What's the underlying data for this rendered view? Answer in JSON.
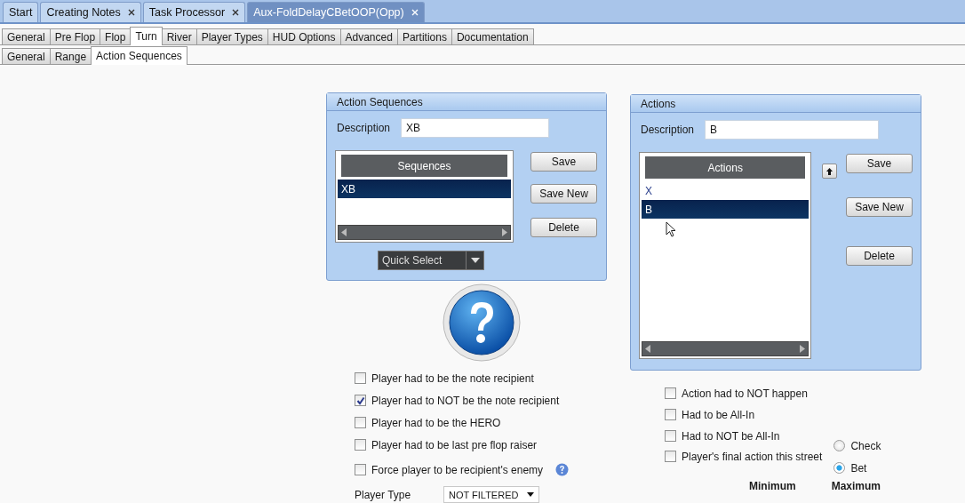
{
  "doc_tabs": [
    {
      "label": "Start",
      "closable": false,
      "selected": false
    },
    {
      "label": "Creating Notes",
      "closable": true,
      "selected": false
    },
    {
      "label": "Task Processor",
      "closable": true,
      "selected": false
    },
    {
      "label": "Aux-FoldDelayCBetOOP(Opp)",
      "closable": true,
      "selected": true
    }
  ],
  "main_tabs": [
    {
      "label": "General",
      "selected": false
    },
    {
      "label": "Pre Flop",
      "selected": false
    },
    {
      "label": "Flop",
      "selected": false
    },
    {
      "label": "Turn",
      "selected": true
    },
    {
      "label": "River",
      "selected": false
    },
    {
      "label": "Player Types",
      "selected": false
    },
    {
      "label": "HUD Options",
      "selected": false
    },
    {
      "label": "Advanced",
      "selected": false
    },
    {
      "label": "Partitions",
      "selected": false
    },
    {
      "label": "Documentation",
      "selected": false
    }
  ],
  "sub_tabs": [
    {
      "label": "General",
      "selected": false
    },
    {
      "label": "Range",
      "selected": false
    },
    {
      "label": "Action Sequences",
      "selected": true
    }
  ],
  "sequences_panel": {
    "title": "Action Sequences",
    "description_label": "Description",
    "description": "XB",
    "list_header": "Sequences",
    "rows": [
      {
        "label": "XB",
        "selected": true
      }
    ],
    "buttons": [
      "Save",
      "Save New",
      "Delete"
    ],
    "quick_select": "Quick Select"
  },
  "actions_panel": {
    "title": "Actions",
    "description_label": "Description",
    "description": "B",
    "list_header": "Actions",
    "rows": [
      {
        "label": "X",
        "selected": false
      },
      {
        "label": "B",
        "selected": true
      }
    ],
    "buttons": [
      "Save",
      "Save New",
      "Delete"
    ]
  },
  "left_options": [
    {
      "label": "Player had to be the note recipient",
      "checked": false,
      "help": false
    },
    {
      "label": "Player had to NOT be the note recipient",
      "checked": true,
      "help": false
    },
    {
      "label": "Player had to be the HERO",
      "checked": false,
      "help": false
    },
    {
      "label": "Player had to be last pre flop raiser",
      "checked": false,
      "help": false
    },
    {
      "label": "Force player to be recipient's enemy",
      "checked": false,
      "help": true
    }
  ],
  "player_type": {
    "label": "Player Type",
    "value": "NOT FILTERED"
  },
  "right_options": [
    {
      "label": "Action had to NOT happen",
      "checked": false
    },
    {
      "label": "Had to be All-In",
      "checked": false
    },
    {
      "label": "Had to NOT be All-In",
      "checked": false
    },
    {
      "label": "Player's final action this street",
      "checked": false
    }
  ],
  "final_action": [
    {
      "label": "Check",
      "selected": false
    },
    {
      "label": "Bet",
      "selected": true
    }
  ],
  "range_headers": [
    "Minimum",
    "Maximum"
  ]
}
